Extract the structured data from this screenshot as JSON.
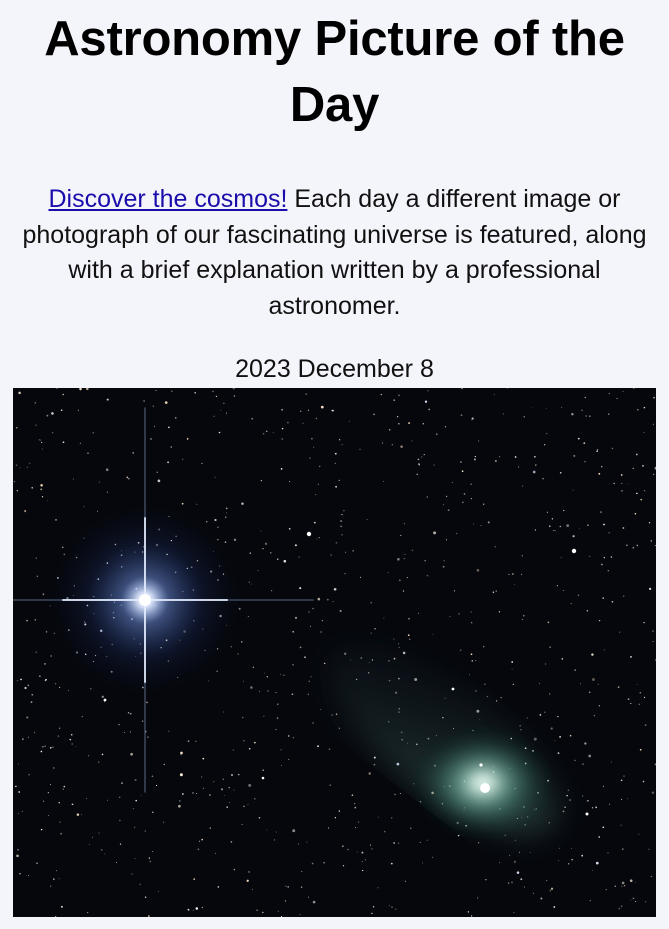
{
  "header": {
    "title": "Astronomy Picture of the Day"
  },
  "intro": {
    "link_text": "Discover the cosmos!",
    "body_text": " Each day a different image or photograph of our fascinating universe is featured, along with a brief explanation written by a professional astronomer."
  },
  "post": {
    "date": "2023 December 8"
  },
  "image": {
    "subject": "bright-star-and-green-comet-starfield",
    "colors": {
      "sky": "#05070c",
      "star_glow": "#7fa6ff",
      "comet_coma": "#8fd6c0"
    }
  }
}
